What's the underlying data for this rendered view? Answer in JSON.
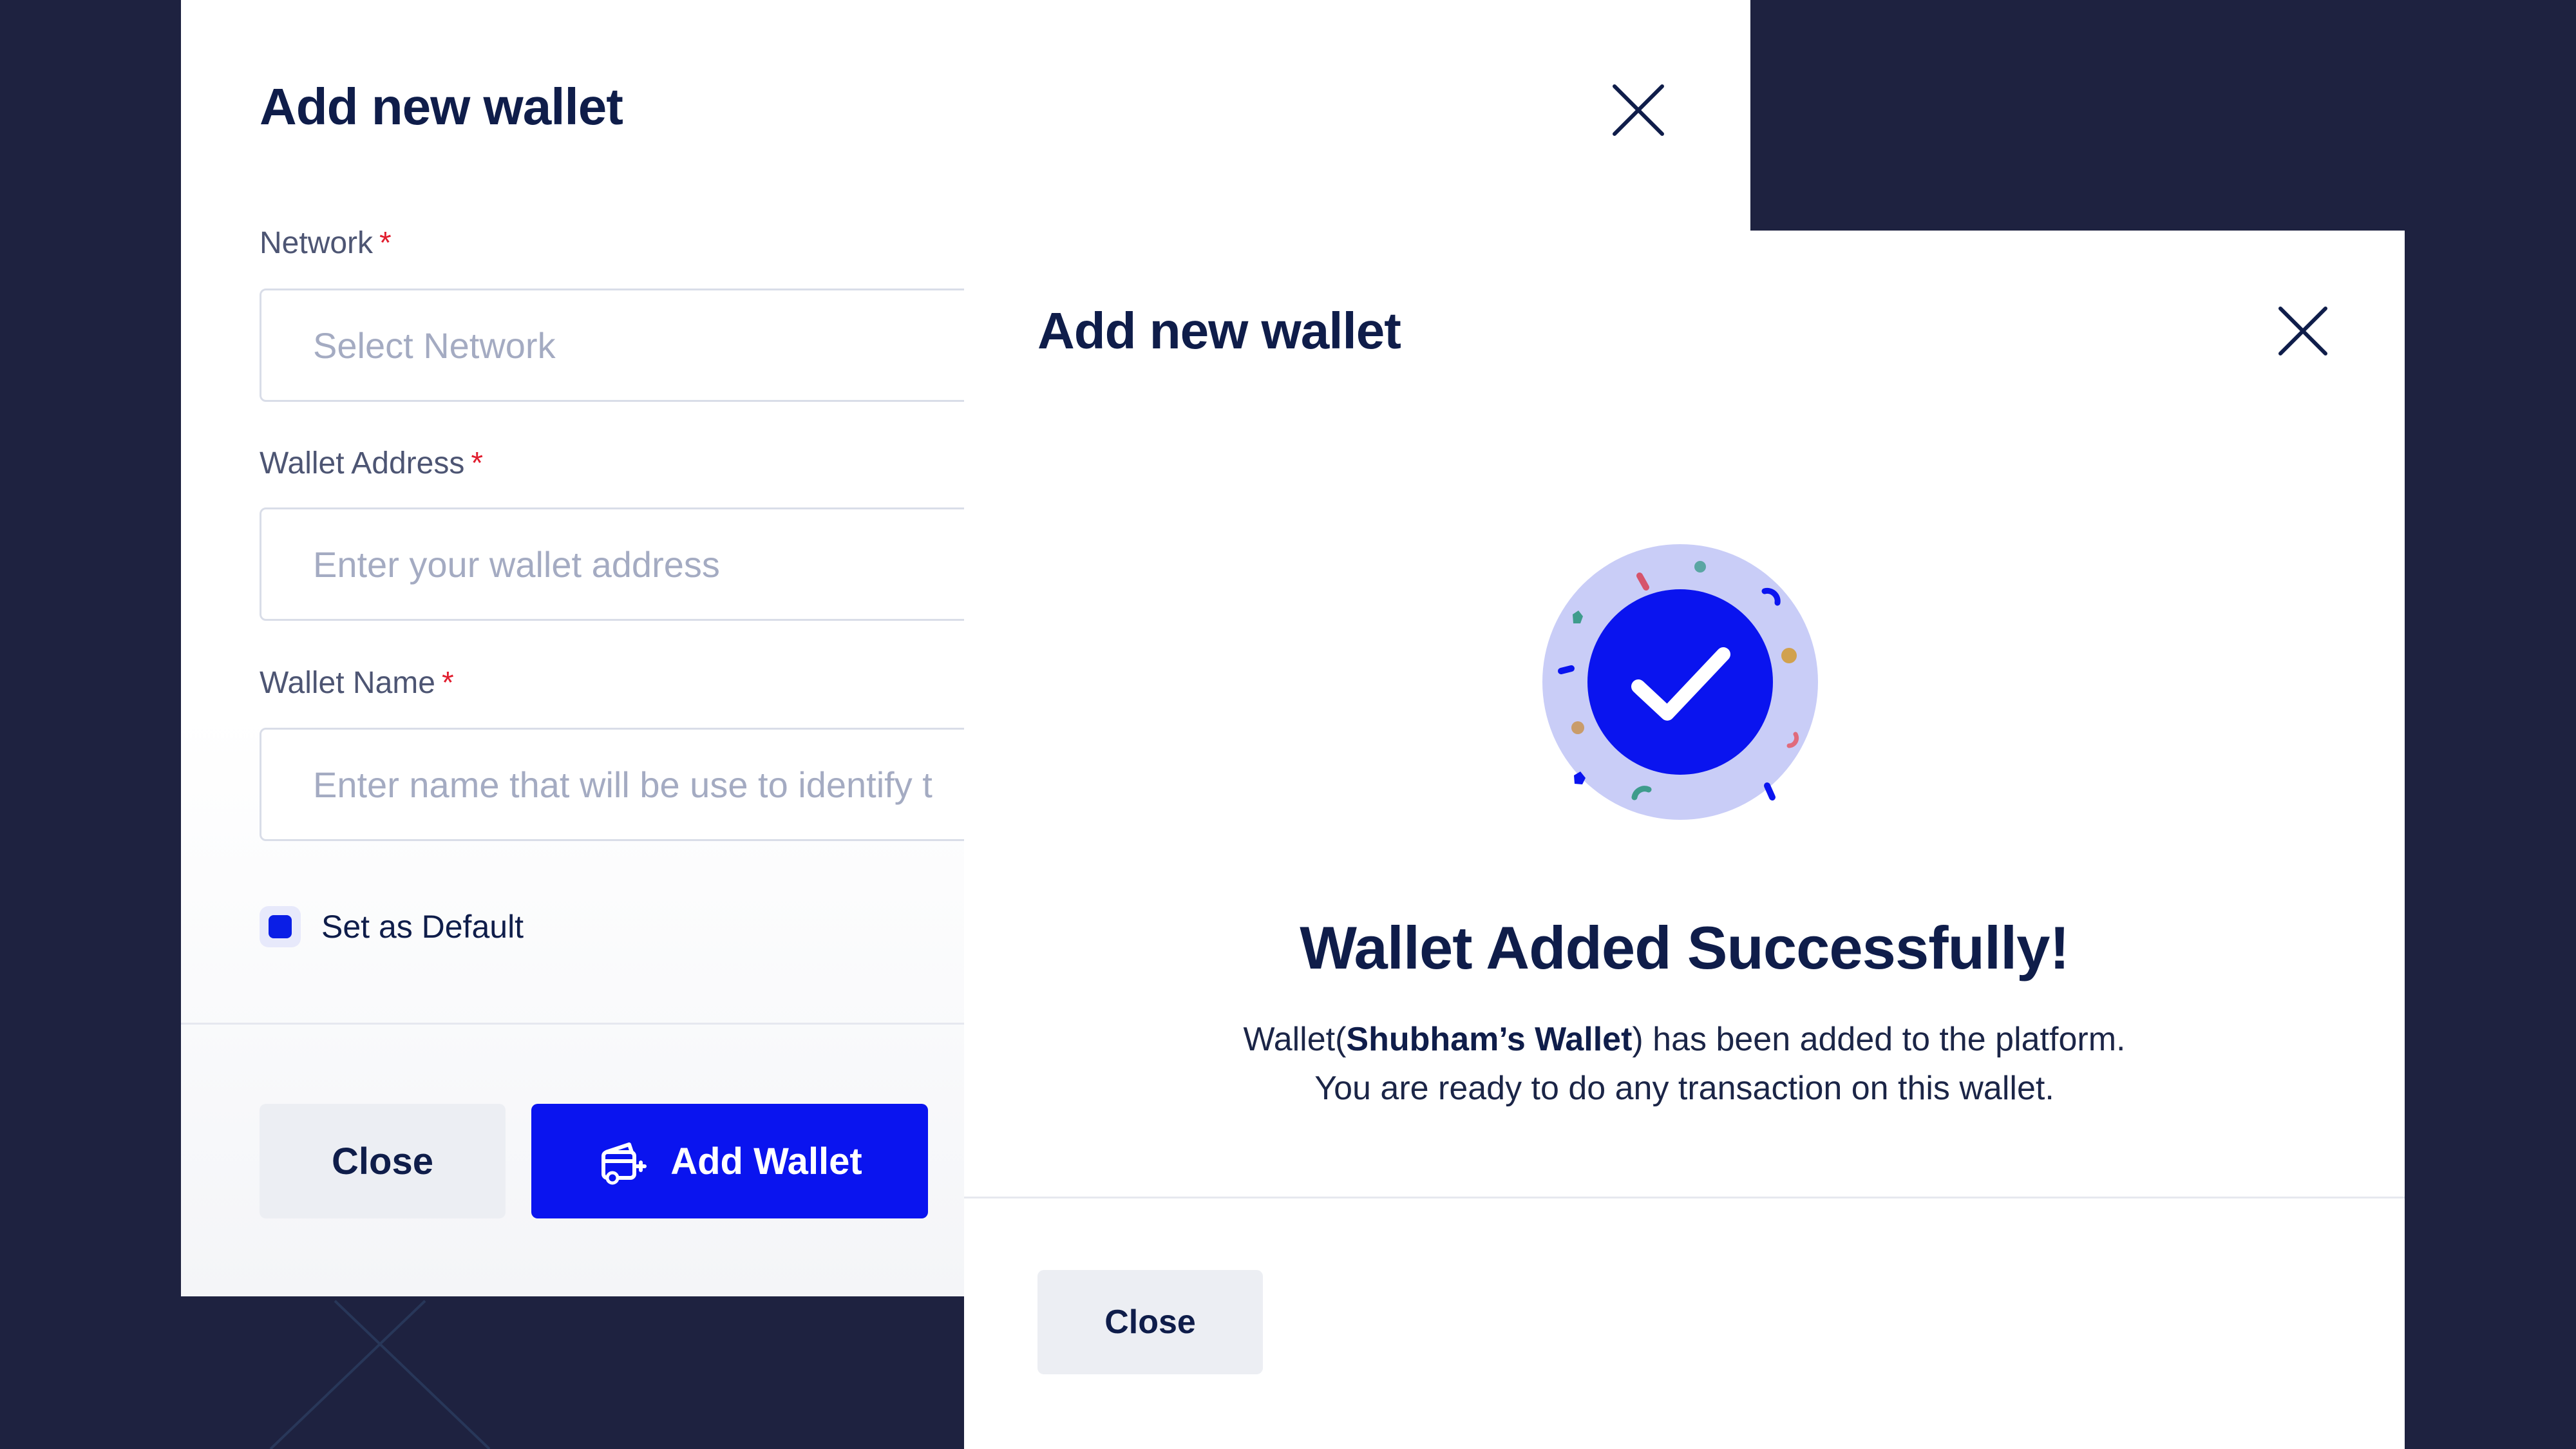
{
  "colors": {
    "background": "#1e2240",
    "primary": "#0a14ef",
    "heading": "#0f1d4a",
    "required": "#e11d2e",
    "muted": "#a4abc2",
    "badge_ring": "#c9cdf7"
  },
  "form_modal": {
    "title": "Add new wallet",
    "close_icon": "close-icon",
    "network": {
      "label": "Network",
      "required_mark": "*",
      "placeholder": "Select Network"
    },
    "wallet_address": {
      "label": "Wallet Address",
      "required_mark": "*",
      "placeholder": "Enter your wallet address"
    },
    "wallet_name": {
      "label": "Wallet Name",
      "required_mark": "*",
      "placeholder": "Enter name that will be use to identify t"
    },
    "set_default": {
      "label": "Set as Default",
      "checked": true
    },
    "close_button": "Close",
    "add_button": "Add Wallet",
    "add_button_icon": "wallet-add-icon"
  },
  "success_modal": {
    "title": "Add new wallet",
    "close_icon": "close-icon",
    "illustration_icon": "success-check-icon",
    "heading": "Wallet Added Successfully!",
    "message_prefix": "Wallet(",
    "wallet_name": "Shubham’s Wallet",
    "message_suffix": ") has been added to the platform.",
    "message_line2": "You are ready to do any transaction on this wallet.",
    "close_button": "Close"
  }
}
